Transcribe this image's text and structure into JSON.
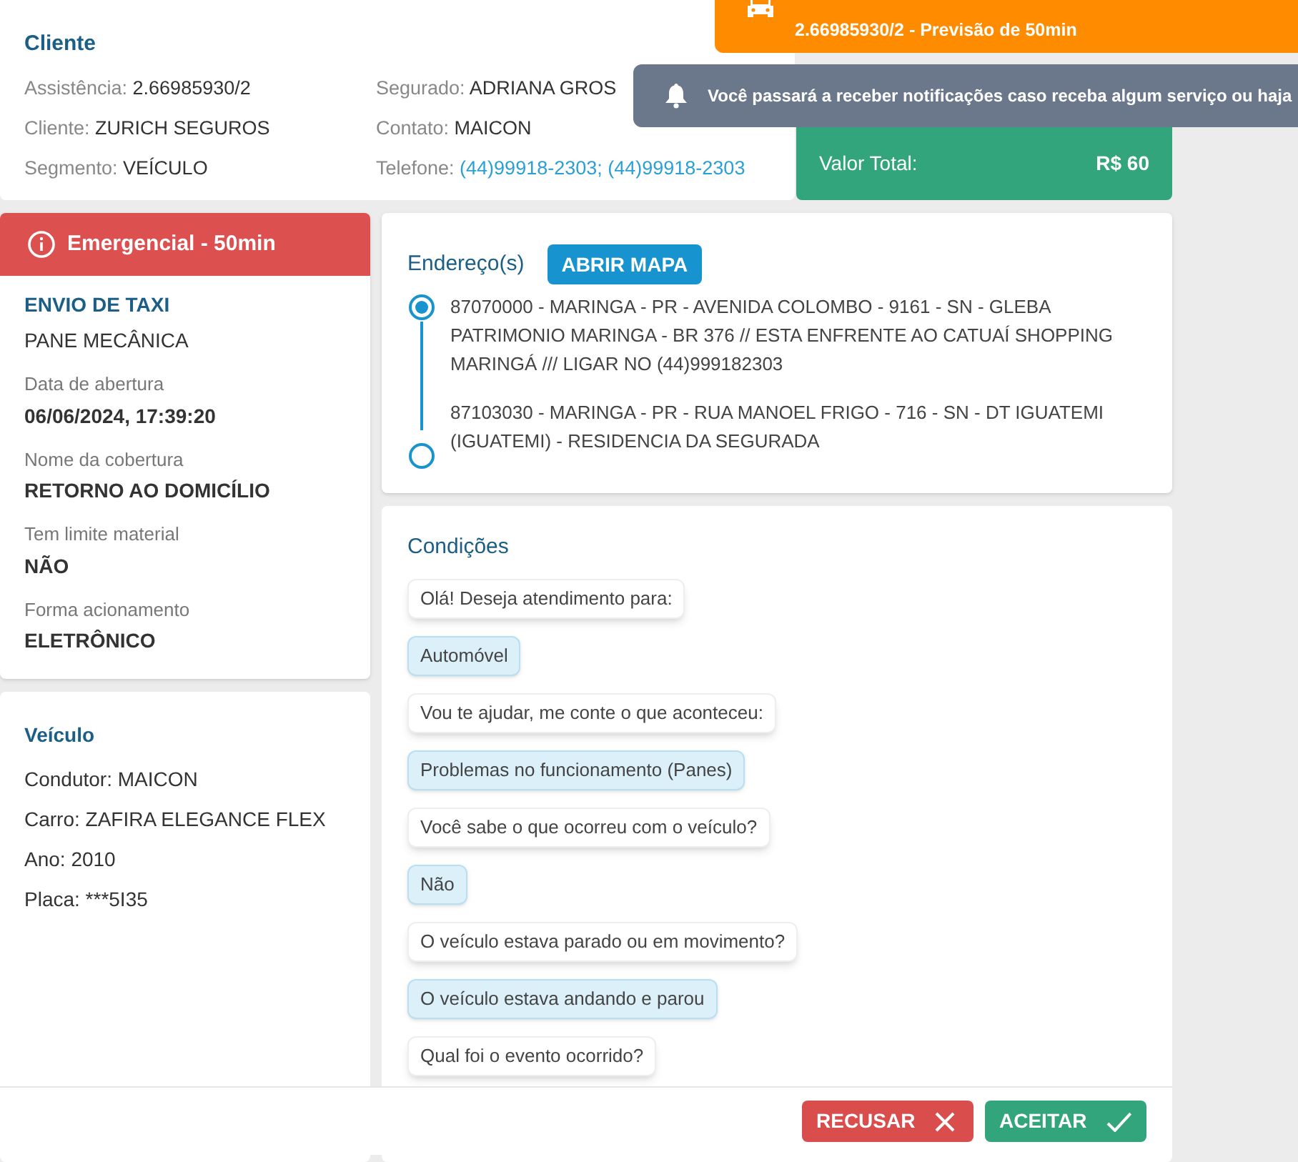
{
  "client": {
    "title": "Cliente",
    "left": [
      {
        "label": "Assistência:",
        "value": "2.66985930/2"
      },
      {
        "label": "Cliente:",
        "value": "ZURICH SEGUROS"
      },
      {
        "label": "Segmento:",
        "value": "VEÍCULO"
      }
    ],
    "right": [
      {
        "label": "Segurado:",
        "value": "ADRIANA GROS",
        "kind": "text"
      },
      {
        "label": "Contato:",
        "value": "MAICON",
        "kind": "text"
      },
      {
        "label": "Telefone:",
        "value": "(44)99918-2303; (44)99918-2303",
        "kind": "link"
      }
    ]
  },
  "total": {
    "label": "Valor Total:",
    "value": "R$ 60"
  },
  "toasts": [
    {
      "kind": "service",
      "text": "2.66985930/2 - Previsão de 50min"
    },
    {
      "kind": "notification",
      "text": "Você passará a receber notificações caso receba algum serviço ou haja"
    }
  ],
  "service": {
    "badge": "Emergencial - 50min",
    "title": "ENVIO DE TAXI",
    "subtitle": "PANE MECÂNICA",
    "fields": [
      {
        "label": "Data de abertura",
        "value": "06/06/2024, 17:39:20"
      },
      {
        "label": "Nome da cobertura",
        "value": "RETORNO AO DOMICÍLIO"
      },
      {
        "label": "Tem limite material",
        "value": "NÃO"
      },
      {
        "label": "Forma acionamento",
        "value": "ELETRÔNICO"
      }
    ]
  },
  "vehicle": {
    "title": "Veículo",
    "fields": [
      "Condutor: MAICON",
      "Carro: ZAFIRA ELEGANCE FLEX",
      "Ano: 2010",
      "Placa: ***5I35"
    ]
  },
  "addresses": {
    "title": "Endereço(s)",
    "button": "ABRIR MAPA",
    "items": [
      {
        "kind": "origin",
        "text": "87070000 - MARINGA - PR - AVENIDA COLOMBO - 9161 - SN - GLEBA PATRIMONIO MARINGA - BR 376 // ESTA ENFRENTE AO CATUAÍ SHOPPING MARINGÁ /// LIGAR NO (44)999182303"
      },
      {
        "kind": "destination",
        "text": "87103030 - MARINGA - PR - RUA MANOEL FRIGO - 716 - SN - DT IGUATEMI (IGUATEMI) - RESIDENCIA DA SEGURADA"
      }
    ]
  },
  "conditions": {
    "title": "Condições",
    "messages": [
      {
        "kind": "question",
        "text": "Olá! Deseja atendimento para:"
      },
      {
        "kind": "answer",
        "text": "Automóvel"
      },
      {
        "kind": "question",
        "text": "Vou te ajudar, me conte o que aconteceu:"
      },
      {
        "kind": "answer",
        "text": "Problemas no funcionamento (Panes)"
      },
      {
        "kind": "question",
        "text": "Você sabe o que ocorreu com o veículo?"
      },
      {
        "kind": "answer",
        "text": "Não"
      },
      {
        "kind": "question",
        "text": "O veículo estava parado ou em movimento?"
      },
      {
        "kind": "answer",
        "text": "O veículo estava andando e parou"
      },
      {
        "kind": "question",
        "text": "Qual foi o evento ocorrido?"
      }
    ]
  },
  "actions": [
    {
      "kind": "reject",
      "label": "RECUSAR"
    },
    {
      "kind": "accept",
      "label": "ACEITAR"
    }
  ]
}
